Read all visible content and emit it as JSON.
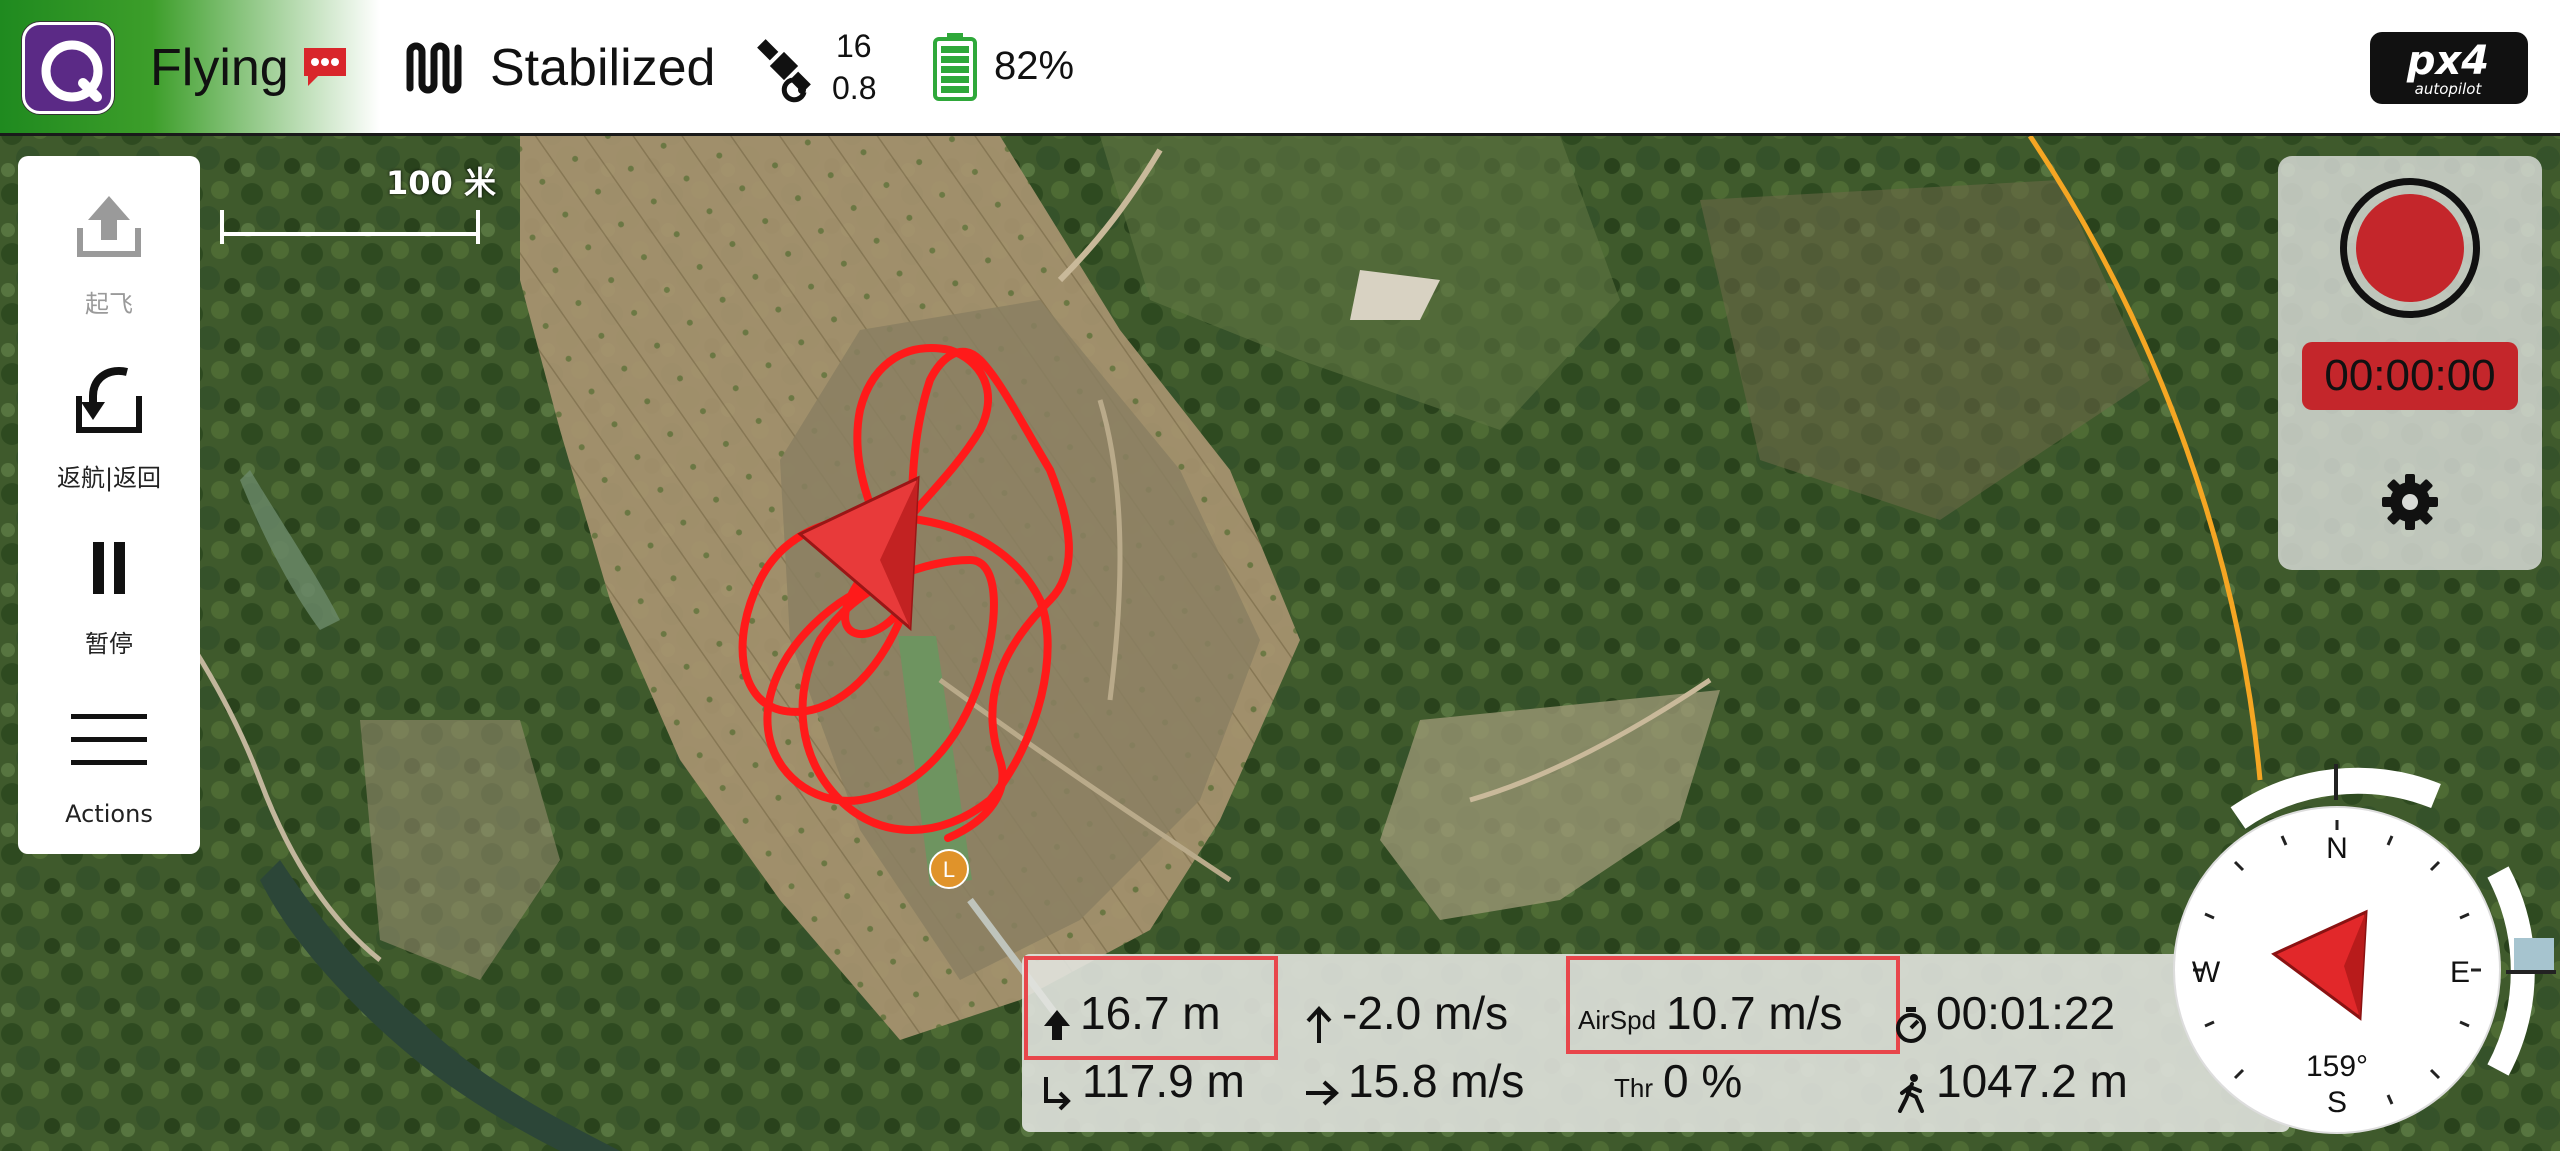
{
  "toolbar": {
    "flight_state": "Flying",
    "flight_mode": "Stabilized",
    "satellites": "16",
    "hdop": "0.8",
    "battery": "82%",
    "brand": "px4 autopilot",
    "accent_green": "#2e8f24",
    "icons": [
      "qgc-logo-icon",
      "message-icon",
      "flight-mode-icon",
      "satellite-icon",
      "battery-icon",
      "px4-logo-icon"
    ]
  },
  "map": {
    "scale_label": "100 米",
    "home_marker": "L",
    "track_color": "#ff1a1a",
    "geofence_color": "#f5a623"
  },
  "tools": [
    {
      "label": "起飞",
      "icon": "takeoff-icon",
      "enabled": false
    },
    {
      "label": "返航|返回",
      "icon": "return-icon",
      "enabled": true
    },
    {
      "label": "暂停",
      "icon": "pause-icon",
      "enabled": true
    },
    {
      "label": "Actions",
      "icon": "menu-icon",
      "enabled": true
    }
  ],
  "camera": {
    "record_time": "00:00:00",
    "record_color": "#c4262b",
    "icons": [
      "record-icon",
      "gear-icon"
    ]
  },
  "telemetry": {
    "altitude": "16.7 m",
    "vertical_speed": "-2.0 m/s",
    "airspeed_label": "AirSpd",
    "airspeed": "10.7 m/s",
    "flight_time": "00:01:22",
    "distance_to_home": "117.9 m",
    "ground_speed": "15.8 m/s",
    "throttle_label": "Thr",
    "throttle": "0 %",
    "distance_traveled": "1047.2 m",
    "highlight_color": "#e8464b"
  },
  "compass": {
    "north": "N",
    "east": "E",
    "south": "S",
    "west": "W",
    "heading": "159°"
  }
}
